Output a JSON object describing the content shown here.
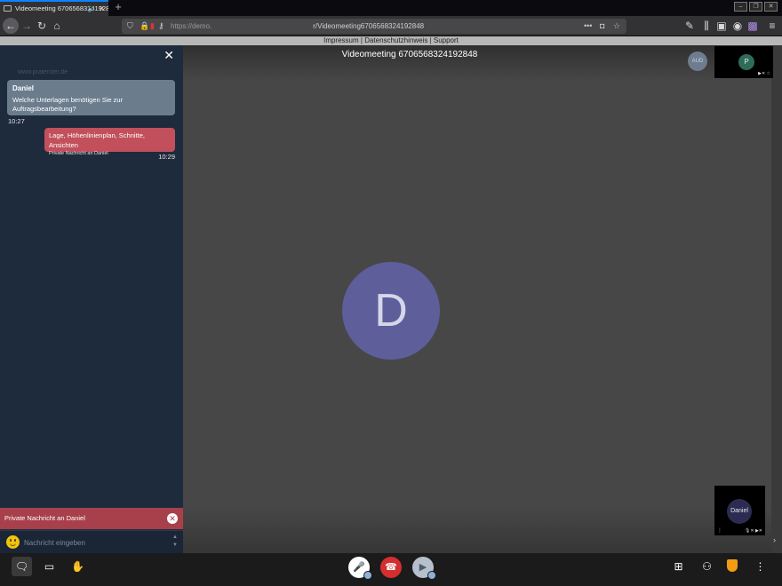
{
  "browser": {
    "tab_title": "Videomeeting 6706568324192848",
    "tab_audio_icon": "speaker-icon",
    "new_tab_label": "+",
    "url_prefix": "https://demo.",
    "url_path": "r/Videomeeting6706568324192848"
  },
  "infobar": {
    "impressum": "Impressum",
    "separator1": " | ",
    "datenschutz": "Datenschutzhinweis",
    "separator2": " | ",
    "support": "Support"
  },
  "chat": {
    "faded_text": "www.pratender.de",
    "incoming": {
      "sender": "Daniel",
      "text": "Welche Unterlagen benötigen Sie zur Auftragsbearbeitung?",
      "time": "10:27"
    },
    "outgoing": {
      "text": "Lage, Höhenlinienplan, Schnitte, Ansichten",
      "subtext": "Private Nachricht an Daniel",
      "time": "10:29"
    },
    "private_banner": "Private Nachricht an Daniel",
    "input_placeholder": "Nachricht eingeben"
  },
  "stage": {
    "meeting_title": "Videomeeting 6706568324192848",
    "aud_badge": "AUD",
    "big_avatar_letter": "D",
    "avatar_color": "#5e5e9b"
  },
  "thumbnails": {
    "p_letter": "P",
    "d_name": "Daniel"
  },
  "colors": {
    "accent_red": "#c1505c",
    "hangup_red": "#d32f2f",
    "chat_bg": "#1e2b3c"
  }
}
